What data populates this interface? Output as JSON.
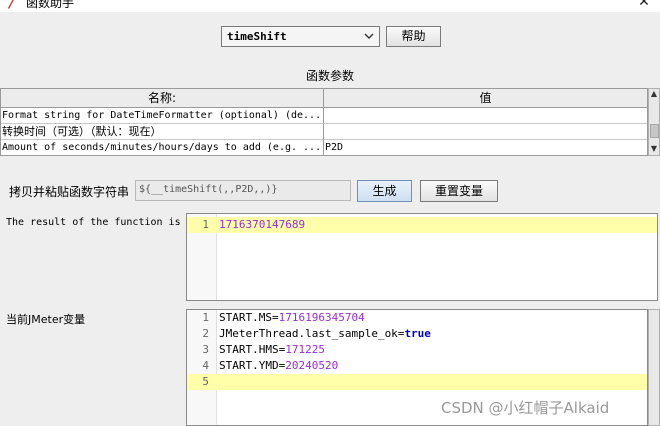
{
  "window": {
    "title": "函数助手",
    "close_glyph": "✕"
  },
  "toolbar": {
    "function_select_value": "timeShift",
    "help_label": "帮助"
  },
  "params": {
    "title": "函数参数",
    "columns": [
      "名称:",
      "值"
    ],
    "rows": [
      {
        "name": "Format string for DateTimeFormatter (optional) (de...",
        "value": ""
      },
      {
        "name": "转换时间（可选）（默认：现在）",
        "value": ""
      },
      {
        "name": "Amount of seconds/minutes/hours/days to add (e.g. ...",
        "value": "P2D"
      }
    ]
  },
  "copy": {
    "label": "拷贝并粘贴函数字符串",
    "value": "${__timeShift(,,P2D,,)}",
    "generate_label": "生成",
    "reset_label": "重置变量"
  },
  "result": {
    "label": "The result of the function is",
    "lines": [
      {
        "n": "1",
        "value": "1716370147689"
      }
    ]
  },
  "vars": {
    "label": "当前JMeter变量",
    "lines": [
      {
        "n": "1",
        "key": "START.MS=",
        "value": "1716196345704"
      },
      {
        "n": "2",
        "key": "JMeterThread.last_sample_ok=",
        "value": "true"
      },
      {
        "n": "3",
        "key": "START.HMS=",
        "value": "171225"
      },
      {
        "n": "4",
        "key": "START.YMD=",
        "value": "20240520"
      },
      {
        "n": "5",
        "key": "",
        "value": ""
      }
    ]
  },
  "watermark": "CSDN @小红帽子Alkaid",
  "colors": {
    "highlight_line": "#ffffaa",
    "number": "#9a2bd6",
    "keyword": "#0000c8"
  }
}
